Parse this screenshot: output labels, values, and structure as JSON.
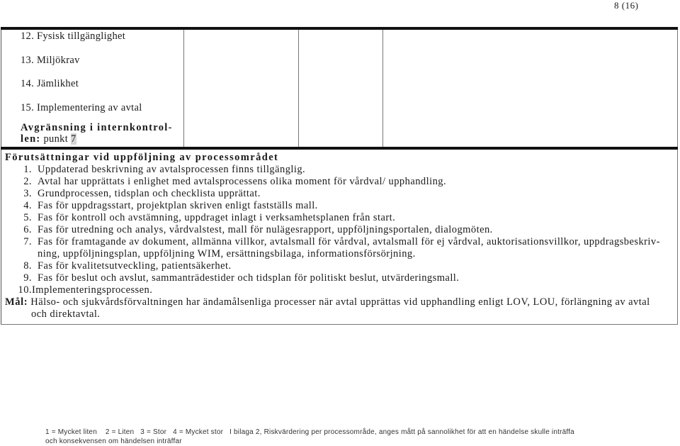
{
  "page": {
    "number": "8 (16)"
  },
  "table": {
    "items": [
      "12. Fysisk tillgänglighet",
      "13. Miljökrav",
      "14. Jämlikhet",
      "15. Implementering av avtal"
    ],
    "limit": {
      "label_line1": "Avgränsning i internkontrol-",
      "label_line2": "len:",
      "text": "punkt",
      "point": "7"
    },
    "conditions": {
      "heading": "Förutsättningar vid uppföljning av processområdet",
      "items": [
        {
          "num": "1.",
          "text": "Uppdaterad beskrivning av avtalsprocessen finns tillgänglig."
        },
        {
          "num": "2.",
          "text": "Avtal har upprättats i enlighet med avtalsprocessens olika moment för vårdval/ upphandling."
        },
        {
          "num": "3.",
          "text": "Grundprocessen, tidsplan och checklista upprättat."
        },
        {
          "num": "4.",
          "text": "Fas för uppdragsstart, projektplan skriven enligt fastställs mall."
        },
        {
          "num": "5.",
          "text": "Fas för kontroll och avstämning, uppdraget inlagt i verksamhetsplanen från start."
        },
        {
          "num": "6.",
          "text": "Fas för utredning och analys, vårdvalstest, mall för nulägesrapport, uppföljningsportalen, dialogmöten."
        },
        {
          "num": "7.",
          "text": "Fas för framtagande av dokument, allmänna villkor, avtalsmall för vårdval, avtalsmall för ej vårdval, auktorisationsvillkor, uppdragsbeskriv-ning, uppföljningsplan, uppföljning WIM, ersättningsbilaga, informationsförsörjning."
        },
        {
          "num": "8.",
          "text": "Fas för kvalitetsutveckling, patientsäkerhet."
        },
        {
          "num": "9.",
          "text": "Fas för beslut och avslut, sammanträdestider och tidsplan för politiskt beslut, utvärderingsmall."
        },
        {
          "num": "10.",
          "text": "Implementeringsprocessen."
        }
      ]
    },
    "goal": {
      "label": "Mål:",
      "text_line1": "Hälso- och sjukvårdsförvaltningen har ändamålsenliga processer när avtal upprättas vid upphandling enligt LOV, LOU, förlängning av avtal",
      "text_line2": "och direktavtal."
    }
  },
  "footnote": {
    "line1": "1 = Mycket liten    2 = Liten   3 = Stor   4 = Mycket stor   I bilaga 2, Riskvärdering per processområde, anges mått på sannolikhet för att en händelse skulle inträffa",
    "line2": "och konsekvensen om händelsen inträffar"
  }
}
